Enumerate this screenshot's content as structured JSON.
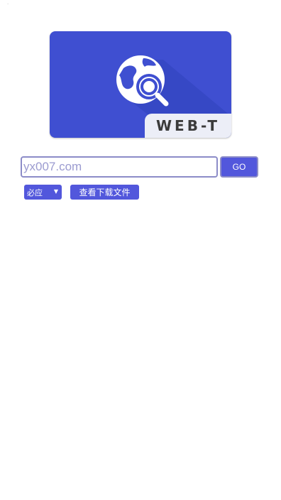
{
  "corner_mark": "·",
  "logo": {
    "text": "WEB-T",
    "icon": "globe-search-icon",
    "colors": {
      "card": "#3f4fd1",
      "tab": "#eceef7",
      "icon": "#ffffff"
    }
  },
  "search": {
    "placeholder": "yx007.com",
    "value": "",
    "go_label": "GO"
  },
  "engine": {
    "selected": "必应",
    "chevron": "▼"
  },
  "downloads": {
    "label": "查看下载文件"
  },
  "colors": {
    "accent": "#5257dc",
    "input_border": "#8c8cc8"
  }
}
